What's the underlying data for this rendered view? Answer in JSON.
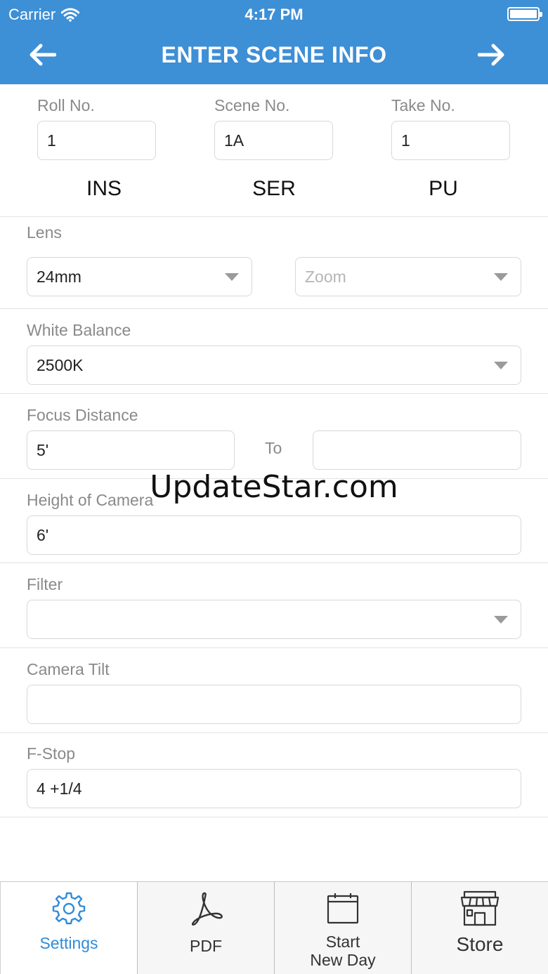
{
  "status_bar": {
    "carrier": "Carrier",
    "time": "4:17 PM"
  },
  "nav": {
    "title": "ENTER SCENE INFO"
  },
  "scene": {
    "roll_label": "Roll No.",
    "roll_value": "1",
    "scene_label": "Scene No.",
    "scene_value": "1A",
    "take_label": "Take No.",
    "take_value": "1",
    "codes": [
      "INS",
      "SER",
      "PU"
    ]
  },
  "lens": {
    "label": "Lens",
    "value": "24mm",
    "zoom_placeholder": "Zoom"
  },
  "white_balance": {
    "label": "White Balance",
    "value": "2500K"
  },
  "focus_distance": {
    "label": "Focus Distance",
    "from": "5'",
    "to_label": "To",
    "to": ""
  },
  "height_of_camera": {
    "label": "Height of Camera",
    "value": "6'"
  },
  "filter": {
    "label": "Filter",
    "value": ""
  },
  "camera_tilt": {
    "label": "Camera Tilt",
    "value": ""
  },
  "f_stop": {
    "label": "F-Stop",
    "value": "4 +1/4"
  },
  "watermark": "UpdateStar.com",
  "tabbar": {
    "settings": "Settings",
    "pdf": "PDF",
    "start_new_day_line1": "Start",
    "start_new_day_line2": "New Day",
    "store": "Store"
  },
  "colors": {
    "header_bg": "#3d8fd6",
    "active_tab": "#2f8bd8"
  }
}
